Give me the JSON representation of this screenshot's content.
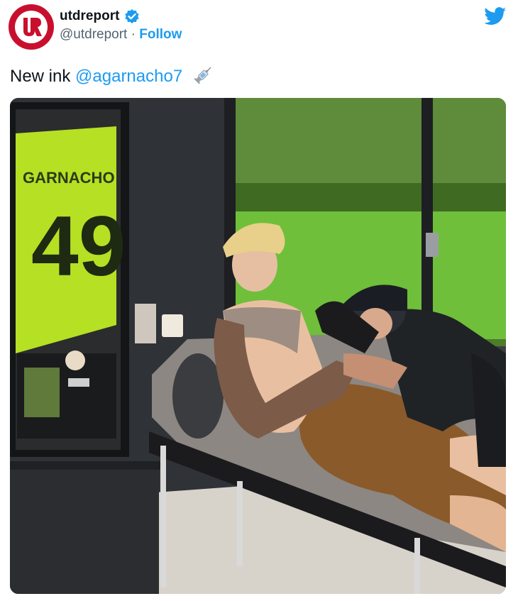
{
  "header": {
    "display_name": "utdreport",
    "handle": "@utdreport",
    "separator": " · ",
    "follow_label": "Follow",
    "avatar_icon": "utdreport-logo-icon",
    "verified_icon": "verified-badge-icon",
    "platform_icon": "twitter-bird-icon"
  },
  "tweet": {
    "text": "New ink",
    "mention": "@agarnacho7",
    "emoji": "syringe-icon"
  },
  "photo": {
    "jersey_name": "GARNACHO",
    "jersey_number": "49",
    "description_icon": "tattoo-session-photo"
  },
  "colors": {
    "brand_red": "#c8102e",
    "link_blue": "#1d9bf0",
    "secondary_text": "#536471",
    "jersey_green": "#b6e024"
  }
}
